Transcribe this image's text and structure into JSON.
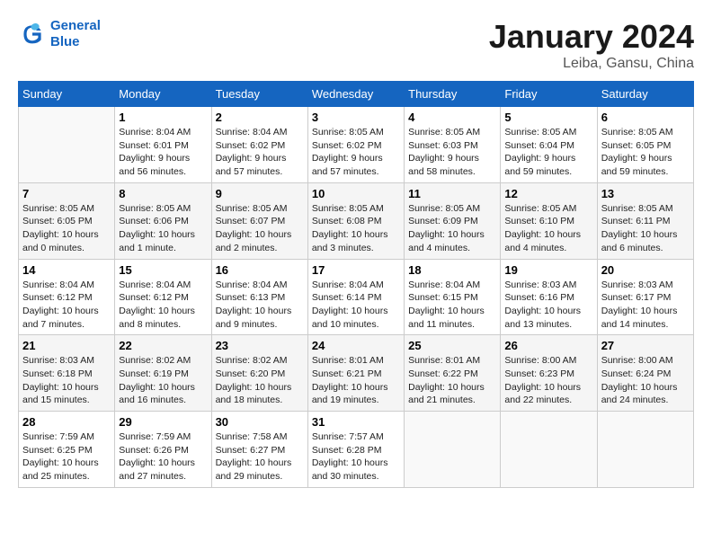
{
  "header": {
    "logo_line1": "General",
    "logo_line2": "Blue",
    "title": "January 2024",
    "subtitle": "Leiba, Gansu, China"
  },
  "calendar": {
    "days_of_week": [
      "Sunday",
      "Monday",
      "Tuesday",
      "Wednesday",
      "Thursday",
      "Friday",
      "Saturday"
    ],
    "weeks": [
      [
        {
          "date": "",
          "info": ""
        },
        {
          "date": "1",
          "info": "Sunrise: 8:04 AM\nSunset: 6:01 PM\nDaylight: 9 hours\nand 56 minutes."
        },
        {
          "date": "2",
          "info": "Sunrise: 8:04 AM\nSunset: 6:02 PM\nDaylight: 9 hours\nand 57 minutes."
        },
        {
          "date": "3",
          "info": "Sunrise: 8:05 AM\nSunset: 6:02 PM\nDaylight: 9 hours\nand 57 minutes."
        },
        {
          "date": "4",
          "info": "Sunrise: 8:05 AM\nSunset: 6:03 PM\nDaylight: 9 hours\nand 58 minutes."
        },
        {
          "date": "5",
          "info": "Sunrise: 8:05 AM\nSunset: 6:04 PM\nDaylight: 9 hours\nand 59 minutes."
        },
        {
          "date": "6",
          "info": "Sunrise: 8:05 AM\nSunset: 6:05 PM\nDaylight: 9 hours\nand 59 minutes."
        }
      ],
      [
        {
          "date": "7",
          "info": "Sunrise: 8:05 AM\nSunset: 6:05 PM\nDaylight: 10 hours\nand 0 minutes."
        },
        {
          "date": "8",
          "info": "Sunrise: 8:05 AM\nSunset: 6:06 PM\nDaylight: 10 hours\nand 1 minute."
        },
        {
          "date": "9",
          "info": "Sunrise: 8:05 AM\nSunset: 6:07 PM\nDaylight: 10 hours\nand 2 minutes."
        },
        {
          "date": "10",
          "info": "Sunrise: 8:05 AM\nSunset: 6:08 PM\nDaylight: 10 hours\nand 3 minutes."
        },
        {
          "date": "11",
          "info": "Sunrise: 8:05 AM\nSunset: 6:09 PM\nDaylight: 10 hours\nand 4 minutes."
        },
        {
          "date": "12",
          "info": "Sunrise: 8:05 AM\nSunset: 6:10 PM\nDaylight: 10 hours\nand 4 minutes."
        },
        {
          "date": "13",
          "info": "Sunrise: 8:05 AM\nSunset: 6:11 PM\nDaylight: 10 hours\nand 6 minutes."
        }
      ],
      [
        {
          "date": "14",
          "info": "Sunrise: 8:04 AM\nSunset: 6:12 PM\nDaylight: 10 hours\nand 7 minutes."
        },
        {
          "date": "15",
          "info": "Sunrise: 8:04 AM\nSunset: 6:12 PM\nDaylight: 10 hours\nand 8 minutes."
        },
        {
          "date": "16",
          "info": "Sunrise: 8:04 AM\nSunset: 6:13 PM\nDaylight: 10 hours\nand 9 minutes."
        },
        {
          "date": "17",
          "info": "Sunrise: 8:04 AM\nSunset: 6:14 PM\nDaylight: 10 hours\nand 10 minutes."
        },
        {
          "date": "18",
          "info": "Sunrise: 8:04 AM\nSunset: 6:15 PM\nDaylight: 10 hours\nand 11 minutes."
        },
        {
          "date": "19",
          "info": "Sunrise: 8:03 AM\nSunset: 6:16 PM\nDaylight: 10 hours\nand 13 minutes."
        },
        {
          "date": "20",
          "info": "Sunrise: 8:03 AM\nSunset: 6:17 PM\nDaylight: 10 hours\nand 14 minutes."
        }
      ],
      [
        {
          "date": "21",
          "info": "Sunrise: 8:03 AM\nSunset: 6:18 PM\nDaylight: 10 hours\nand 15 minutes."
        },
        {
          "date": "22",
          "info": "Sunrise: 8:02 AM\nSunset: 6:19 PM\nDaylight: 10 hours\nand 16 minutes."
        },
        {
          "date": "23",
          "info": "Sunrise: 8:02 AM\nSunset: 6:20 PM\nDaylight: 10 hours\nand 18 minutes."
        },
        {
          "date": "24",
          "info": "Sunrise: 8:01 AM\nSunset: 6:21 PM\nDaylight: 10 hours\nand 19 minutes."
        },
        {
          "date": "25",
          "info": "Sunrise: 8:01 AM\nSunset: 6:22 PM\nDaylight: 10 hours\nand 21 minutes."
        },
        {
          "date": "26",
          "info": "Sunrise: 8:00 AM\nSunset: 6:23 PM\nDaylight: 10 hours\nand 22 minutes."
        },
        {
          "date": "27",
          "info": "Sunrise: 8:00 AM\nSunset: 6:24 PM\nDaylight: 10 hours\nand 24 minutes."
        }
      ],
      [
        {
          "date": "28",
          "info": "Sunrise: 7:59 AM\nSunset: 6:25 PM\nDaylight: 10 hours\nand 25 minutes."
        },
        {
          "date": "29",
          "info": "Sunrise: 7:59 AM\nSunset: 6:26 PM\nDaylight: 10 hours\nand 27 minutes."
        },
        {
          "date": "30",
          "info": "Sunrise: 7:58 AM\nSunset: 6:27 PM\nDaylight: 10 hours\nand 29 minutes."
        },
        {
          "date": "31",
          "info": "Sunrise: 7:57 AM\nSunset: 6:28 PM\nDaylight: 10 hours\nand 30 minutes."
        },
        {
          "date": "",
          "info": ""
        },
        {
          "date": "",
          "info": ""
        },
        {
          "date": "",
          "info": ""
        }
      ]
    ]
  }
}
